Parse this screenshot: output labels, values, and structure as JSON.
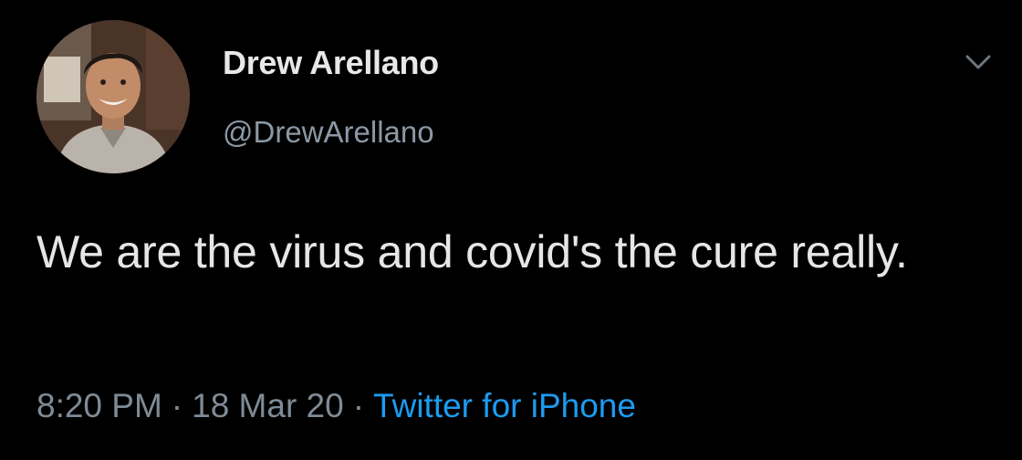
{
  "tweet": {
    "display_name": "Drew Arellano",
    "handle": "@DrewArellano",
    "text": "We are the virus and covid's the cure really.",
    "time": "8:20 PM",
    "separator": "·",
    "date": "18 Mar 20",
    "source": "Twitter for iPhone"
  },
  "icons": {
    "caret": "chevron-down-icon",
    "avatar": "profile-photo"
  },
  "colors": {
    "background": "#000000",
    "name": "#e8e8e8",
    "handle": "#8b98a5",
    "meta": "#7f8b96",
    "link": "#1d9bf0"
  }
}
